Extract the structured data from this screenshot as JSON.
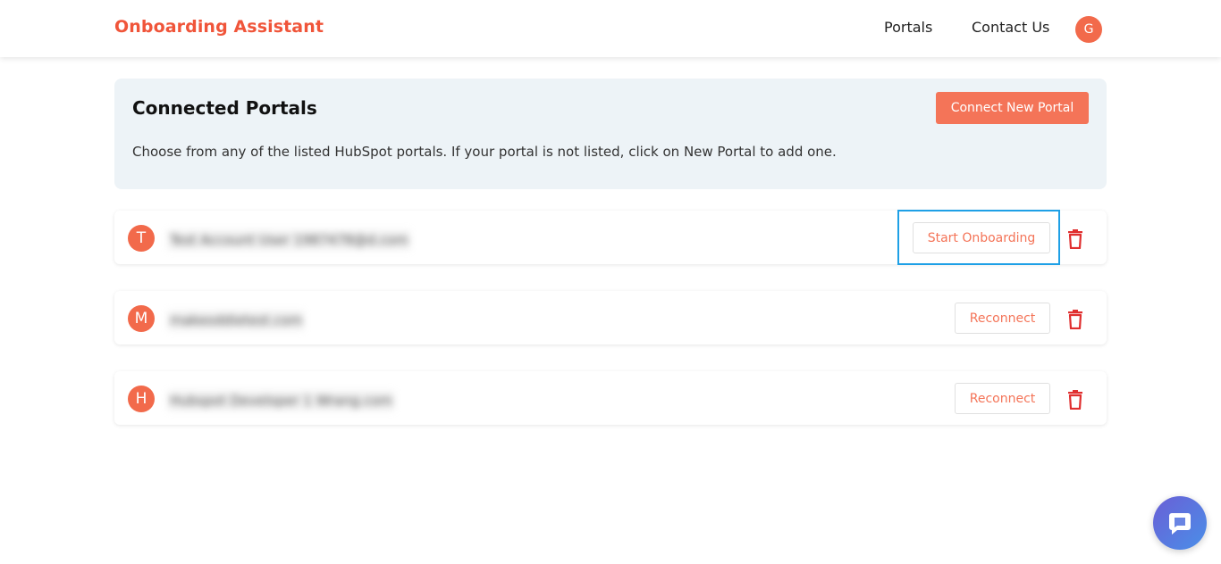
{
  "header": {
    "brand": "Onboarding Assistant",
    "nav": [
      "Portals",
      "Contact Us"
    ],
    "user_initial": "G"
  },
  "panel": {
    "title": "Connected Portals",
    "description": "Choose from any of the listed HubSpot portals. If your portal is not listed, click on New Portal to add one.",
    "connect_button": "Connect New Portal"
  },
  "portals": [
    {
      "initial": "T",
      "name": "Test Account User 1987478@d.com",
      "action": "Start Onboarding"
    },
    {
      "initial": "M",
      "name": "makeoddietest.com",
      "action": "Reconnect"
    },
    {
      "initial": "H",
      "name": "Hubspot Developer 1 Wrang.com",
      "action": "Reconnect"
    }
  ],
  "colors": {
    "accent": "#f47458",
    "brand": "#f0553a",
    "trash": "#e02f2f",
    "focus": "#1ea0e6"
  }
}
